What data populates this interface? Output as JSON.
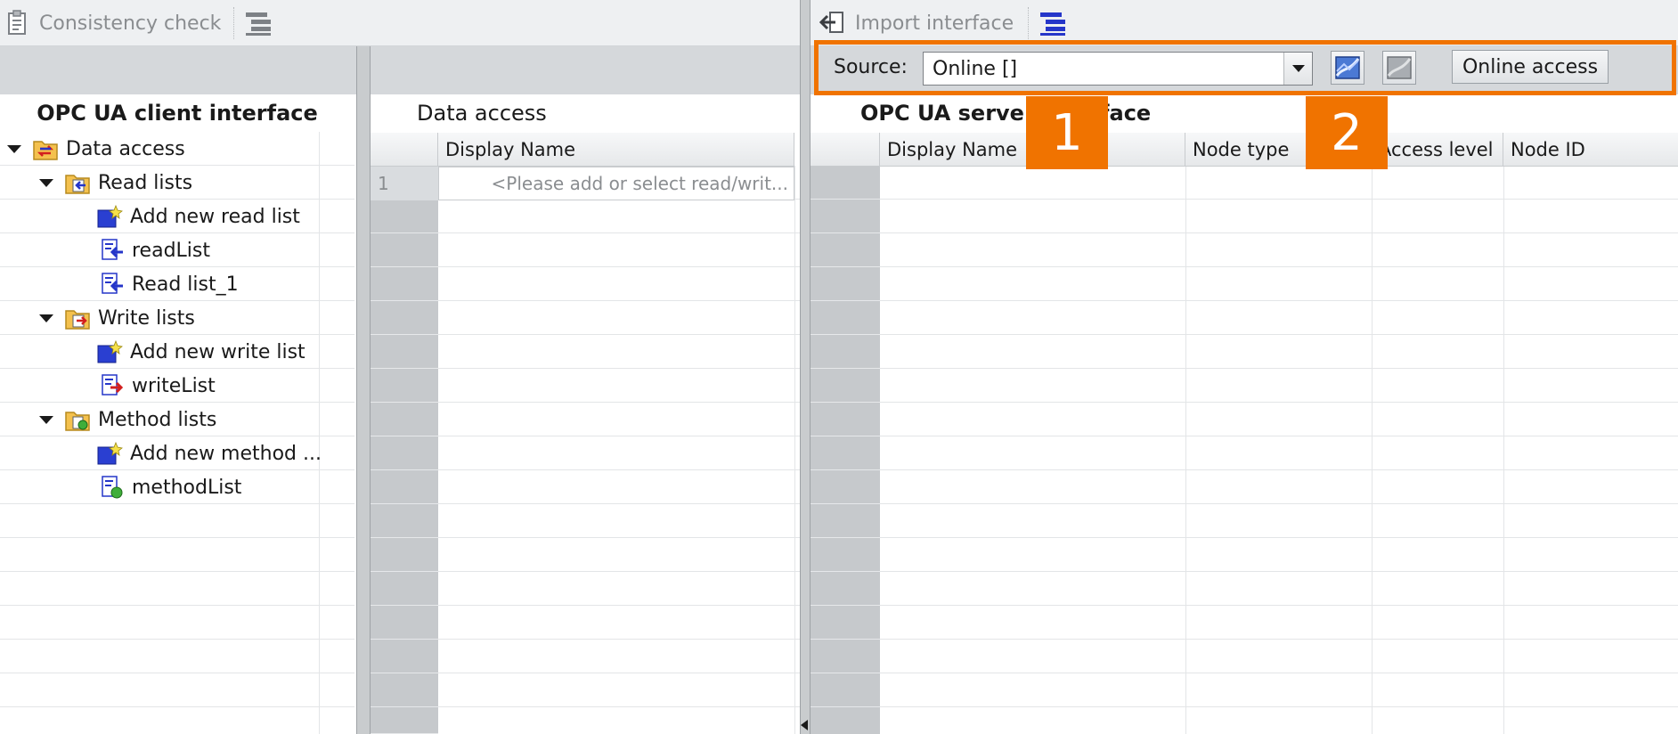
{
  "left_toolbar": {
    "consistency_check_label": "Consistency check"
  },
  "right_toolbar": {
    "import_interface_label": "Import interface",
    "source_label": "Source:",
    "source_value": "Online []",
    "online_access_label": "Online access"
  },
  "client_panel": {
    "title": "OPC UA client interface",
    "tree": [
      {
        "label": "Data access",
        "level": 0,
        "icon": "data-access-folder-icon",
        "expanded": true
      },
      {
        "label": "Read lists",
        "level": 1,
        "icon": "read-lists-folder-icon",
        "expanded": true
      },
      {
        "label": "Add new read list",
        "level": 2,
        "icon": "add-new-icon"
      },
      {
        "label": "readList",
        "level": 2,
        "icon": "read-list-icon"
      },
      {
        "label": "Read list_1",
        "level": 2,
        "icon": "read-list-icon"
      },
      {
        "label": "Write lists",
        "level": 1,
        "icon": "write-lists-folder-icon",
        "expanded": true
      },
      {
        "label": "Add new write list",
        "level": 2,
        "icon": "add-new-icon"
      },
      {
        "label": "writeList",
        "level": 2,
        "icon": "write-list-icon"
      },
      {
        "label": "Method lists",
        "level": 1,
        "icon": "method-lists-folder-icon",
        "expanded": true
      },
      {
        "label": "Add new method ...",
        "level": 2,
        "icon": "add-new-icon"
      },
      {
        "label": "methodList",
        "level": 2,
        "icon": "method-list-icon"
      }
    ]
  },
  "data_access_panel": {
    "title": "Data access",
    "column_header": "Display Name",
    "rows": [
      {
        "num": "1",
        "placeholder": "<Please add or select read/writ..."
      }
    ]
  },
  "server_panel": {
    "title": "OPC UA server interface",
    "columns": [
      "Display Name",
      "Node type",
      "Access level",
      "Node ID"
    ]
  },
  "callouts": [
    "1",
    "2"
  ],
  "colors": {
    "callout": "#f07300",
    "row_header": "#c6c9cc",
    "toolbar": "#eef0f2",
    "bar": "#d5d8db"
  }
}
